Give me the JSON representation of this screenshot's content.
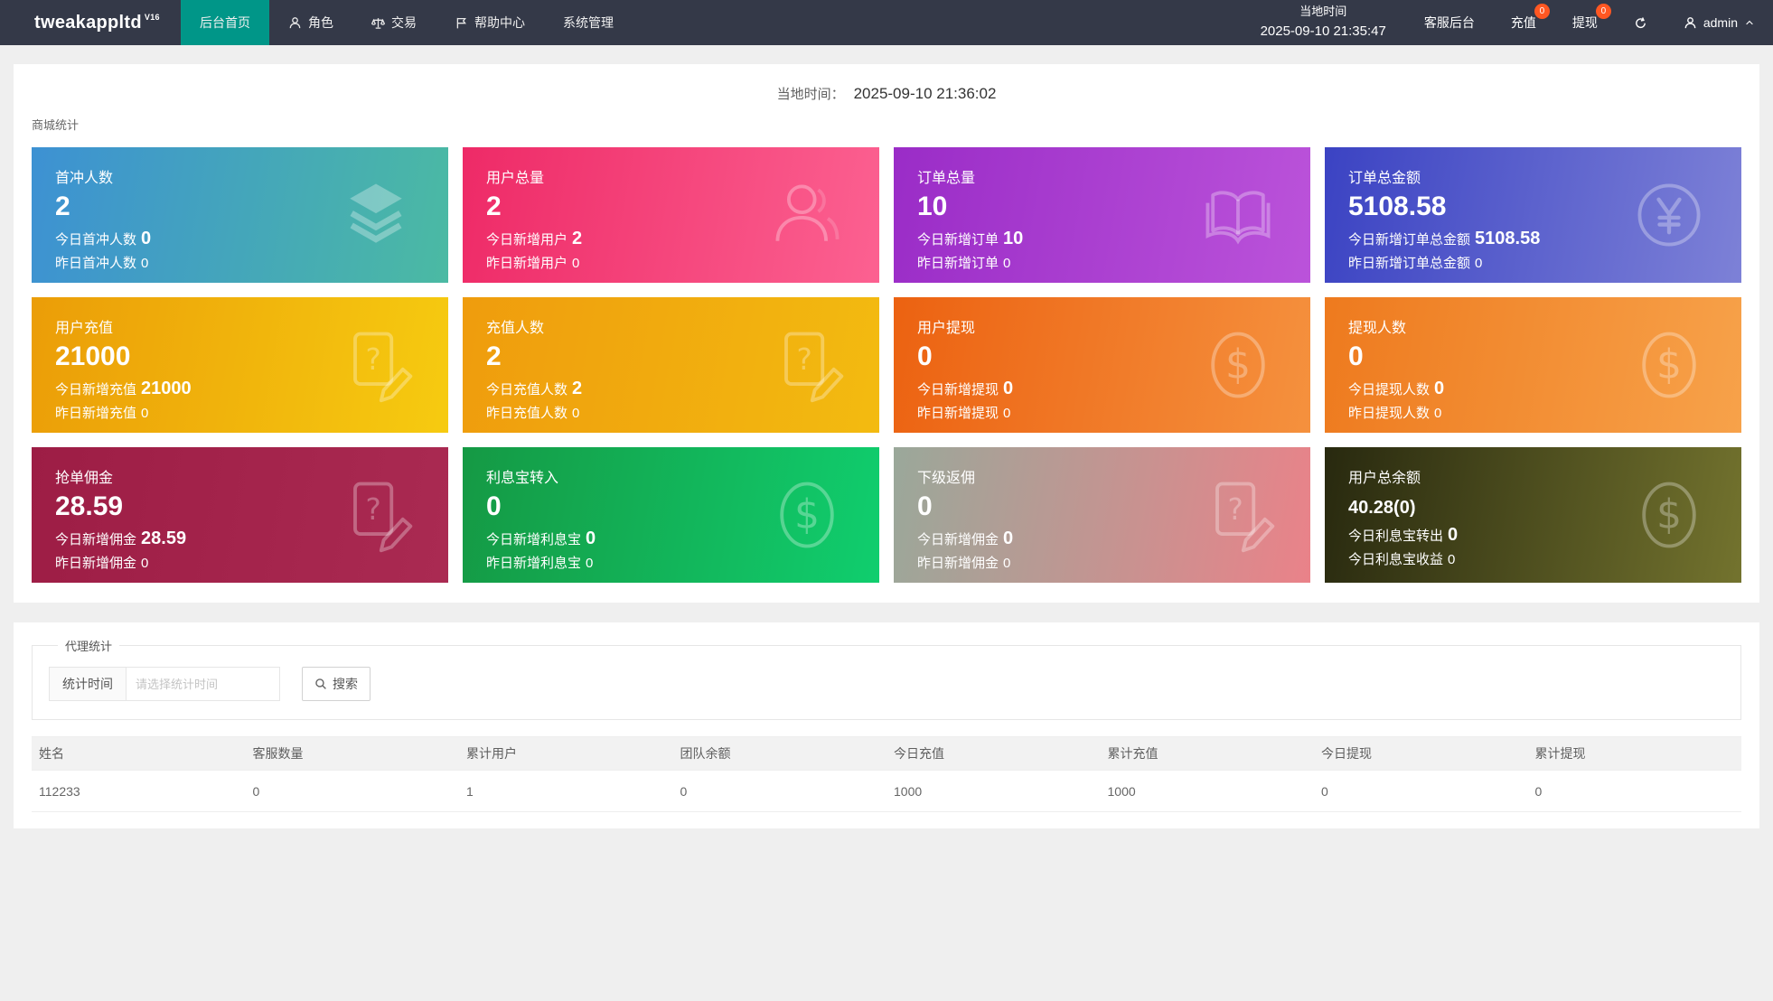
{
  "navbar": {
    "brand": "tweakappltd",
    "brand_sup": "V16",
    "menu": [
      {
        "label": "后台首页"
      },
      {
        "label": "角色"
      },
      {
        "label": "交易"
      },
      {
        "label": "帮助中心"
      },
      {
        "label": "系统管理"
      }
    ],
    "local_time_label": "当地时间",
    "local_time_value": "2025-09-10 21:35:47",
    "service_label": "客服后台",
    "recharge_label": "充值",
    "recharge_badge": "0",
    "withdraw_label": "提现",
    "withdraw_badge": "0",
    "user": "admin"
  },
  "overview": {
    "time_label": "当地时间：",
    "time_value": "2025-09-10 21:36:02",
    "section_title": "商城统计",
    "cards": [
      {
        "title": "首冲人数",
        "value": "2",
        "line1_label": "今日首冲人数",
        "line1_value": "0",
        "line2_label": "昨日首冲人数",
        "line2_value": "0",
        "icon": "layers-icon",
        "g1": "#3d91d3",
        "g2": "#4bbaa3"
      },
      {
        "title": "用户总量",
        "value": "2",
        "line1_label": "今日新增用户",
        "line1_value": "2",
        "line2_label": "昨日新增用户",
        "line2_value": "0",
        "icon": "user-icon",
        "g1": "#ee2a67",
        "g2": "#fc6191"
      },
      {
        "title": "订单总量",
        "value": "10",
        "line1_label": "今日新增订单",
        "line1_value": "10",
        "line2_label": "昨日新增订单",
        "line2_value": "0",
        "icon": "book-icon",
        "g1": "#9a2cc7",
        "g2": "#bb53da"
      },
      {
        "title": "订单总金额",
        "value": "5108.58",
        "line1_label": "今日新增订单总金额",
        "line1_value": "5108.58",
        "line2_label": "昨日新增订单总金额",
        "line2_value": "0",
        "icon": "yen-icon",
        "g1": "#3b43c3",
        "g2": "#7d81d7"
      },
      {
        "title": "用户充值",
        "value": "21000",
        "line1_label": "今日新增充值",
        "line1_value": "21000",
        "line2_label": "昨日新增充值",
        "line2_value": "0",
        "icon": "edit-note-icon",
        "g1": "#eb9d08",
        "g2": "#f6cb10"
      },
      {
        "title": "充值人数",
        "value": "2",
        "line1_label": "今日充值人数",
        "line1_value": "2",
        "line2_label": "昨日充值人数",
        "line2_value": "0",
        "icon": "edit-note-icon",
        "g1": "#ef9c0d",
        "g2": "#f3bb10"
      },
      {
        "title": "用户提现",
        "value": "0",
        "line1_label": "今日新增提现",
        "line1_value": "0",
        "line2_label": "昨日新增提现",
        "line2_value": "0",
        "icon": "dollar-icon",
        "g1": "#ec6211",
        "g2": "#f5913e"
      },
      {
        "title": "提现人数",
        "value": "0",
        "line1_label": "今日提现人数",
        "line1_value": "0",
        "line2_label": "昨日提现人数",
        "line2_value": "0",
        "icon": "dollar-icon",
        "g1": "#ee7a1e",
        "g2": "#f7a24a"
      },
      {
        "title": "抢单佣金",
        "value": "28.59",
        "line1_label": "今日新增佣金",
        "line1_value": "28.59",
        "line2_label": "昨日新增佣金",
        "line2_value": "0",
        "icon": "edit-note-icon",
        "g1": "#9d1d45",
        "g2": "#aa2a52"
      },
      {
        "title": "利息宝转入",
        "value": "0",
        "line1_label": "今日新增利息宝",
        "line1_value": "0",
        "line2_label": "昨日新增利息宝",
        "line2_value": "0",
        "icon": "dollar-icon",
        "g1": "#159944",
        "g2": "#10ce6e"
      },
      {
        "title": "下级返佣",
        "value": "0",
        "line1_label": "今日新增佣金",
        "line1_value": "0",
        "line2_label": "昨日新增佣金",
        "line2_value": "0",
        "icon": "edit-note-icon",
        "g1": "#9aa89a",
        "g2": "#ea8289"
      },
      {
        "title": "用户总余额",
        "value": "40.28(0)",
        "line1_label": "今日利息宝转出",
        "line1_value": "0",
        "line2_label": "今日利息宝收益",
        "line2_value": "0",
        "icon": "dollar-icon",
        "g1": "#28290f",
        "g2": "#73732e"
      }
    ]
  },
  "agent": {
    "legend": "代理统计",
    "filter_label": "统计时间",
    "filter_placeholder": "请选择统计时间",
    "search_label": "搜索",
    "table": {
      "headers": [
        "姓名",
        "客服数量",
        "累计用户",
        "团队余额",
        "今日充值",
        "累计充值",
        "今日提现",
        "累计提现"
      ],
      "rows": [
        [
          "112233",
          "0",
          "1",
          "0",
          "1000",
          "1000",
          "0",
          "0"
        ]
      ]
    }
  }
}
